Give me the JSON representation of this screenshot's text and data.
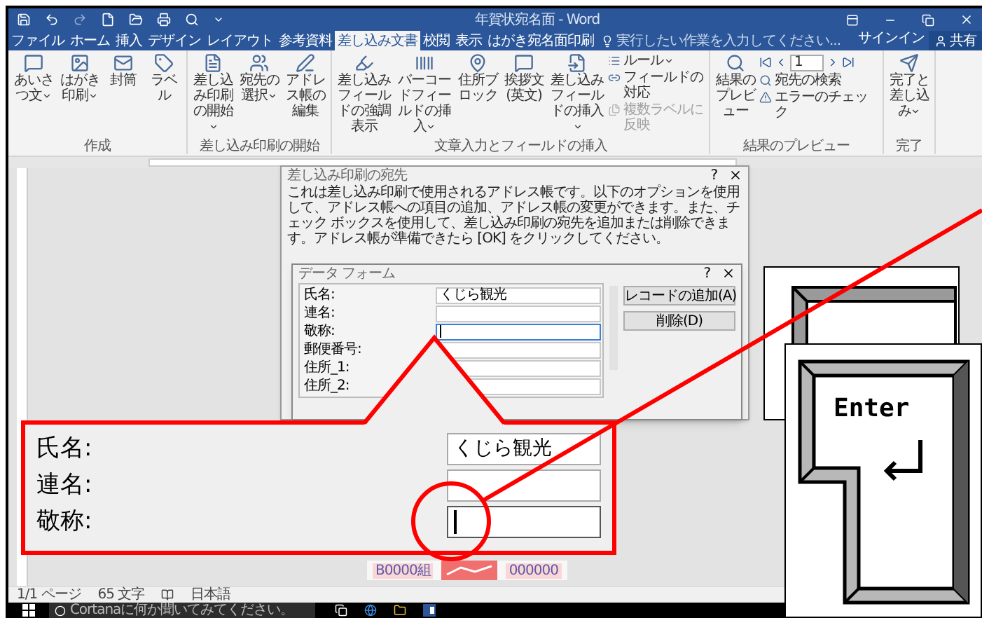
{
  "window": {
    "title": "年賀状宛名面 - Word",
    "tell_me": {
      "placeholder": "実行したい作業を入力してください..."
    },
    "sign_in": "サインイン",
    "share": "共有"
  },
  "ribbon_tabs": [
    {
      "label": "ファイル",
      "selected": false
    },
    {
      "label": "ホーム",
      "selected": false
    },
    {
      "label": "挿入",
      "selected": false
    },
    {
      "label": "デザイン",
      "selected": false
    },
    {
      "label": "レイアウト",
      "selected": false
    },
    {
      "label": "参考資料",
      "selected": false
    },
    {
      "label": "差し込み文書",
      "selected": true
    },
    {
      "label": "校閲",
      "selected": false
    },
    {
      "label": "表示",
      "selected": false
    },
    {
      "label": "はがき宛名面印刷",
      "selected": false
    }
  ],
  "ribbon_groups": [
    {
      "label": "作成",
      "items": [
        {
          "kind": "large",
          "label": "あいさつ文",
          "dropdown": true
        },
        {
          "kind": "large",
          "label": "はがき印刷",
          "dropdown": true
        },
        {
          "kind": "large",
          "label": "封筒",
          "dropdown": false
        },
        {
          "kind": "large",
          "label": "ラベル",
          "dropdown": false
        }
      ]
    },
    {
      "label": "差し込み印刷の開始",
      "items": [
        {
          "kind": "large",
          "label": "差し込み印刷の開始",
          "dropdown": true
        },
        {
          "kind": "large",
          "label": "宛先の選択",
          "dropdown": true
        },
        {
          "kind": "large",
          "label": "アドレス帳の編集",
          "dropdown": false
        }
      ]
    },
    {
      "label": "文章入力とフィールドの挿入",
      "items": [
        {
          "kind": "large",
          "label": "差し込みフィールドの強調表示",
          "dropdown": false
        },
        {
          "kind": "large",
          "label": "バーコードフィールドの挿入",
          "dropdown": true
        },
        {
          "kind": "large",
          "label": "住所ブロック",
          "dropdown": false
        },
        {
          "kind": "large",
          "label": "挨拶文(英文)",
          "dropdown": false
        },
        {
          "kind": "large",
          "label": "差し込みフィールドの挿入",
          "dropdown": true
        },
        {
          "kind": "small",
          "label": "ルール",
          "dropdown": true,
          "disabled": false
        },
        {
          "kind": "small",
          "label": "フィールドの対応",
          "dropdown": false,
          "disabled": false
        },
        {
          "kind": "small",
          "label": "複数ラベルに反映",
          "dropdown": false,
          "disabled": true
        }
      ]
    },
    {
      "label": "結果のプレビュー",
      "items": [
        {
          "kind": "large",
          "label": "結果のプレビュー",
          "dropdown": false
        },
        {
          "kind": "navigator",
          "record": "1"
        },
        {
          "kind": "small",
          "label": "宛先の検索",
          "dropdown": false,
          "disabled": false
        },
        {
          "kind": "small",
          "label": "エラーのチェック",
          "dropdown": false,
          "disabled": false
        }
      ]
    },
    {
      "label": "完了",
      "items": [
        {
          "kind": "large",
          "label": "完了と差し込み",
          "dropdown": true
        }
      ]
    }
  ],
  "dialog": {
    "title": "差し込み印刷の宛先",
    "help_glyph": "?",
    "description": "これは差し込み印刷で使用されるアドレス帳です。以下のオプションを使用して、アドレス帳への項目の追加、アドレス帳の変更ができます。また、チェック ボックスを使用して、差し込み印刷の宛先を追加または削除できます。アドレス帳が準備できたら [OK] をクリックしてください。"
  },
  "data_form": {
    "title": "データ フォーム",
    "help_glyph": "?",
    "fields": [
      {
        "label": "氏名:",
        "value": "くじら観光",
        "focused": false
      },
      {
        "label": "連名:",
        "focused": false
      },
      {
        "label": "敬称:",
        "focused": true
      },
      {
        "label": "郵便番号:",
        "focused": false
      },
      {
        "label": "住所_1:",
        "focused": false
      },
      {
        "label": "住所_2:",
        "focused": false
      }
    ],
    "buttons": [
      "レコードの追加(A)",
      "削除(D)"
    ]
  },
  "callout": {
    "fields": [
      {
        "label": "氏名:",
        "value": "くじら観光",
        "focused": false
      },
      {
        "label": "連名:",
        "focused": false
      },
      {
        "label": "敬称:",
        "focused": true
      }
    ]
  },
  "keyboard": {
    "key_label": "Enter"
  },
  "document": {
    "preview": [
      "B0000組",
      "000000"
    ]
  },
  "status_bar": {
    "page": "1/1 ページ",
    "words": "65 文字",
    "language": "日本語"
  },
  "taskbar": {
    "search": {
      "placeholder": "Cortanaに何か聞いてみてください。"
    }
  }
}
